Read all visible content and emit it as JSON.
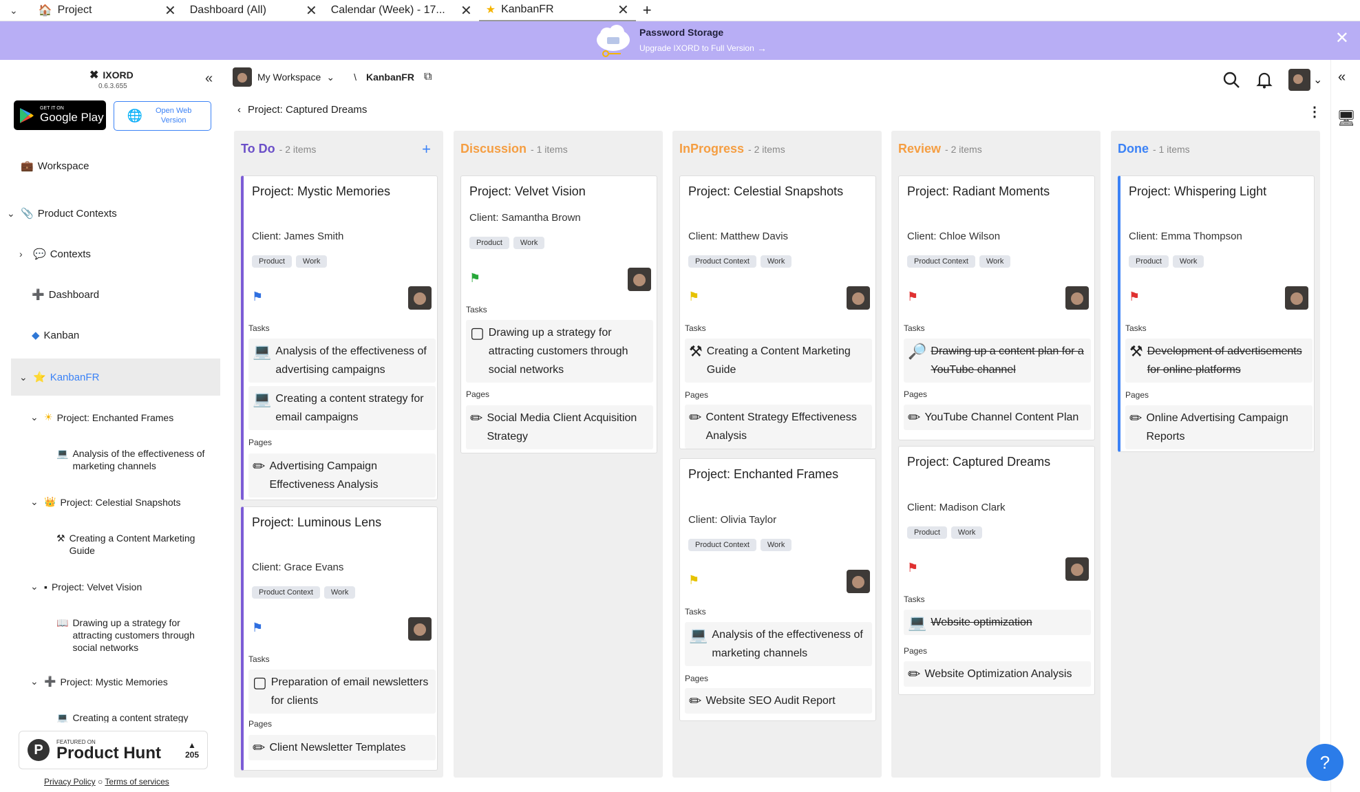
{
  "browser": {
    "tabs": [
      {
        "label": "Project",
        "icon": "home-icon"
      },
      {
        "label": "Dashboard (All)"
      },
      {
        "label": "Calendar (Week) - 17..."
      },
      {
        "label": "KanbanFR",
        "icon": "star-icon"
      }
    ],
    "new_tab": "+"
  },
  "banner": {
    "title": "Password Storage",
    "subtitle": "Upgrade IXORD to Full Version",
    "background": "#b8aef5"
  },
  "app": {
    "name": "IXORD",
    "version": "0.6.3.655"
  },
  "store": {
    "gplay_small": "GET IT ON",
    "gplay_big": "Google Play",
    "web": "Open Web Version"
  },
  "sidebar": {
    "workspace": "Workspace",
    "product_contexts": "Product Contexts",
    "contexts": "Contexts",
    "dashboard": "Dashboard",
    "kanban": "Kanban",
    "kanbanfr": "KanbanFR",
    "projects": [
      {
        "name": "Project: Enchanted Frames",
        "child": "Analysis of the effectiveness of marketing channels"
      },
      {
        "name": "Project: Celestial Snapshots",
        "child": "Creating a Content Marketing Guide"
      },
      {
        "name": "Project: Velvet Vision",
        "child": "Drawing up a strategy for attracting customers through social networks"
      },
      {
        "name": "Project: Mystic Memories",
        "child": "Creating a content strategy"
      }
    ],
    "ph_featured": "FEATURED ON",
    "ph_name": "Product Hunt",
    "ph_votes": "205",
    "privacy": "Privacy Policy",
    "terms": "Terms of services"
  },
  "topbar": {
    "workspace": "My Workspace",
    "separator": "\\",
    "board": "KanbanFR"
  },
  "breadcrumb": "Project: Captured Dreams",
  "columns": [
    {
      "name": "To Do",
      "count": "- 2 items",
      "color": "#6b4fc8"
    },
    {
      "name": "Discussion",
      "count": "- 1 items",
      "color": "#f59e42"
    },
    {
      "name": "InProgress",
      "count": "- 2 items",
      "color": "#f59e42"
    },
    {
      "name": "Review",
      "count": "- 2 items",
      "color": "#f59e42"
    },
    {
      "name": "Done",
      "count": "- 1 items",
      "color": "#3b82f6"
    }
  ],
  "labels": {
    "tasks": "Tasks",
    "pages": "Pages"
  },
  "cards": {
    "c1": {
      "title": "Project: Mystic Memories",
      "client": "Client: James Smith",
      "tags": [
        "Product",
        "Work"
      ],
      "tasks": [
        "Analysis of the effectiveness of advertising campaigns",
        "Creating a content strategy for email campaigns"
      ],
      "pages": [
        "Advertising Campaign Effectiveness Analysis"
      ]
    },
    "c2": {
      "title": "Project: Luminous Lens",
      "client": "Client: Grace Evans",
      "tags": [
        "Product Context",
        "Work"
      ],
      "tasks": [
        "Preparation of email newsletters for clients"
      ],
      "pages": [
        "Client Newsletter Templates"
      ]
    },
    "c3": {
      "title": "Project: Velvet Vision",
      "client": "Client: Samantha Brown",
      "tags": [
        "Product",
        "Work"
      ],
      "tasks": [
        "Drawing up a strategy for attracting customers through social networks"
      ],
      "pages": [
        "Social Media Client Acquisition Strategy"
      ]
    },
    "c4": {
      "title": "Project: Celestial Snapshots",
      "client": "Client: Matthew Davis",
      "tags": [
        "Product Context",
        "Work"
      ],
      "tasks": [
        "Creating a Content Marketing Guide"
      ],
      "pages": [
        "Content Strategy Effectiveness Analysis"
      ]
    },
    "c5": {
      "title": "Project: Enchanted Frames",
      "client": "Client: Olivia Taylor",
      "tags": [
        "Product Context",
        "Work"
      ],
      "tasks": [
        "Analysis of the effectiveness of marketing channels"
      ],
      "pages": [
        "Website SEO Audit Report"
      ]
    },
    "c6": {
      "title": "Project: Radiant Moments",
      "client": "Client: Chloe Wilson",
      "tags": [
        "Product Context",
        "Work"
      ],
      "tasks": [
        "Drawing up a content plan for a YouTube channel"
      ],
      "pages": [
        "YouTube Channel Content Plan"
      ]
    },
    "c7": {
      "title": "Project: Captured Dreams",
      "client": "Client: Madison Clark",
      "tags": [
        "Product",
        "Work"
      ],
      "tasks": [
        "Website optimization"
      ],
      "pages": [
        "Website Optimization Analysis"
      ]
    },
    "c8": {
      "title": "Project: Whispering Light",
      "client": "Client: Emma Thompson",
      "tags": [
        "Product",
        "Work"
      ],
      "tasks": [
        "Development of advertisements for online platforms"
      ],
      "pages": [
        "Online Advertising Campaign Reports"
      ]
    }
  },
  "help": "?"
}
